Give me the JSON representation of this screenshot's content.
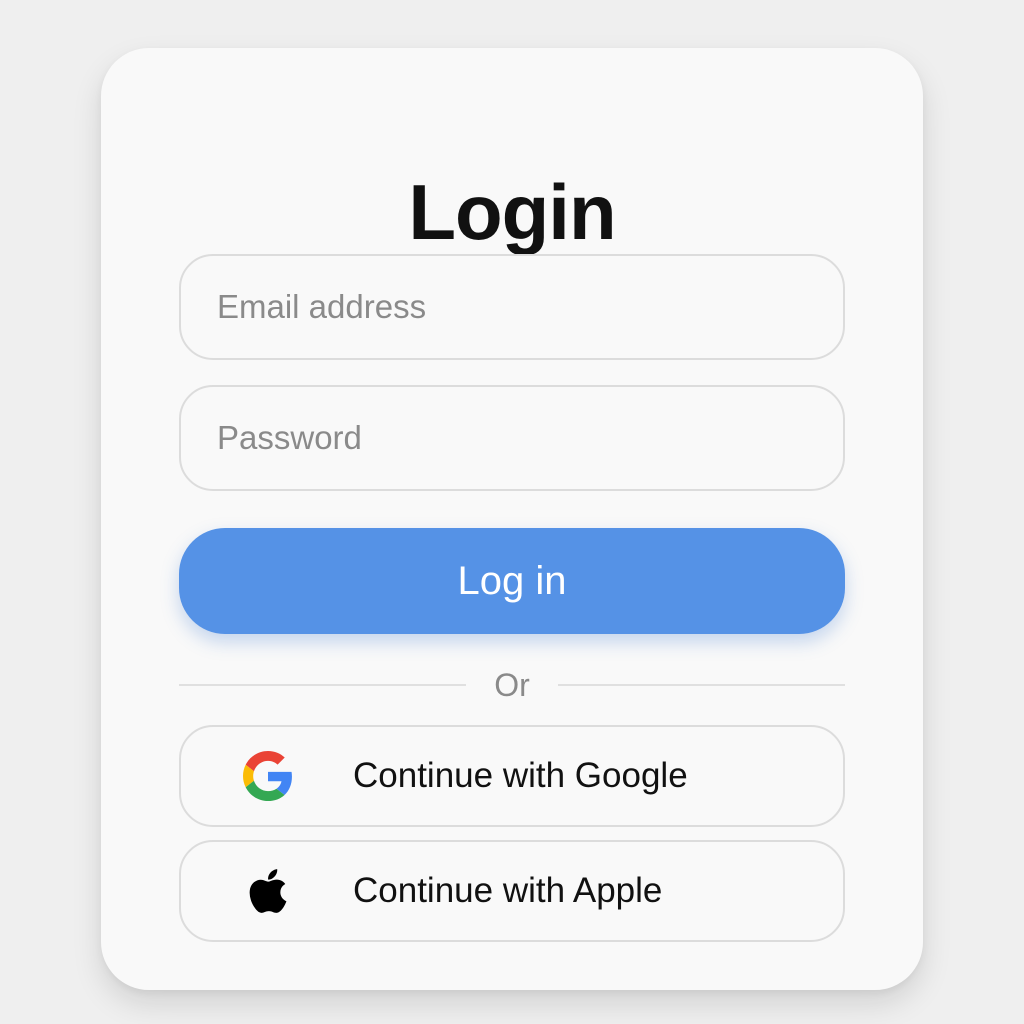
{
  "login": {
    "title": "Login",
    "email": {
      "placeholder": "Email address",
      "value": ""
    },
    "password": {
      "placeholder": "Password",
      "value": ""
    },
    "submit_label": "Log in",
    "divider_label": "Or",
    "oauth": {
      "google": {
        "label": "Continue with Google",
        "icon": "google-icon"
      },
      "apple": {
        "label": "Continue with Apple",
        "icon": "apple-icon"
      }
    }
  },
  "colors": {
    "page_background": "#efefef",
    "card_background": "#f9f9f9",
    "primary_button": "#5592e6",
    "primary_button_text": "#ffffff",
    "border": "#dcdcdc",
    "placeholder_text": "#8a8a8a",
    "title_text": "#111111",
    "google_blue": "#4285F4",
    "google_red": "#EA4335",
    "google_yellow": "#FBBC05",
    "google_green": "#34A853"
  }
}
